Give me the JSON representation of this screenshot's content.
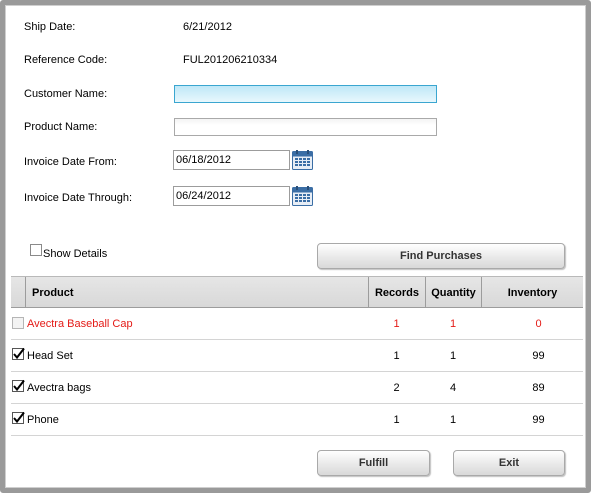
{
  "form": {
    "ship_date_label": "Ship Date:",
    "ship_date_value": "6/21/2012",
    "reference_code_label": "Reference Code:",
    "reference_code_value": "FUL201206210334",
    "customer_name_label": "Customer Name:",
    "customer_name_value": "",
    "product_name_label": "Product Name:",
    "product_name_value": "",
    "invoice_from_label": "Invoice Date From:",
    "invoice_from_value": "06/18/2012",
    "invoice_through_label": "Invoice Date Through:",
    "invoice_through_value": "06/24/2012",
    "show_details_label": "Show Details",
    "show_details_checked": false,
    "find_purchases_label": "Find Purchases"
  },
  "grid": {
    "columns": [
      "Product",
      "Records",
      "Quantity",
      "Inventory"
    ],
    "rows": [
      {
        "product": "Avectra Baseball Cap",
        "records": "1",
        "quantity": "1",
        "inventory": "0",
        "checked": false,
        "disabled": true,
        "highlight": "red"
      },
      {
        "product": "Head Set",
        "records": "1",
        "quantity": "1",
        "inventory": "99",
        "checked": true,
        "disabled": false,
        "highlight": ""
      },
      {
        "product": "Avectra bags",
        "records": "2",
        "quantity": "4",
        "inventory": "89",
        "checked": true,
        "disabled": false,
        "highlight": ""
      },
      {
        "product": "Phone",
        "records": "1",
        "quantity": "1",
        "inventory": "99",
        "checked": true,
        "disabled": false,
        "highlight": ""
      }
    ]
  },
  "footer": {
    "fulfill_label": "Fulfill",
    "exit_label": "Exit"
  },
  "colors": {
    "error_text": "#e41b17",
    "focus_border": "#3aa6d0",
    "calendar_icon": "#3b6ea5"
  }
}
